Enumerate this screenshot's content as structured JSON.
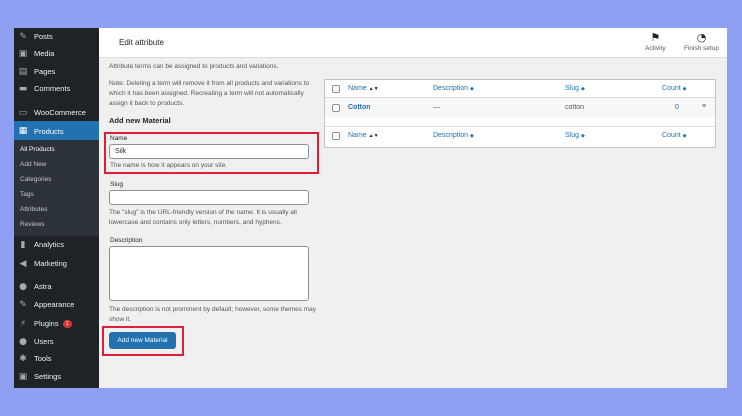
{
  "sidebar": {
    "items": [
      {
        "label": "Posts",
        "icon": "pin-icon"
      },
      {
        "label": "Media",
        "icon": "media-icon"
      },
      {
        "label": "Pages",
        "icon": "pages-icon"
      },
      {
        "label": "Comments",
        "icon": "comments-icon"
      },
      {
        "label": "WooCommerce",
        "icon": "woocommerce-icon"
      },
      {
        "label": "Products",
        "icon": "products-icon"
      },
      {
        "label": "Analytics",
        "icon": "analytics-icon"
      },
      {
        "label": "Marketing",
        "icon": "marketing-icon"
      },
      {
        "label": "Astra",
        "icon": "astra-icon"
      },
      {
        "label": "Appearance",
        "icon": "appearance-icon"
      },
      {
        "label": "Plugins",
        "icon": "plugins-icon",
        "badge": "1"
      },
      {
        "label": "Users",
        "icon": "users-icon"
      },
      {
        "label": "Tools",
        "icon": "tools-icon"
      },
      {
        "label": "Settings",
        "icon": "settings-icon"
      }
    ],
    "submenu": [
      "All Products",
      "Add New",
      "Categories",
      "Tags",
      "Attributes",
      "Reviews"
    ]
  },
  "header": {
    "title": "Edit attribute",
    "activity": "Activity",
    "finish_setup": "Finish setup"
  },
  "form": {
    "intro": "Attribute terms can be assigned to products and variations.",
    "note": "Note: Deleting a term will remove it from all products and variations to which it has been assigned. Recreating a term will not automatically assign it back to products.",
    "heading": "Add new Material",
    "name_label": "Name",
    "name_value": "Silk",
    "name_help": "The name is how it appears on your site.",
    "slug_label": "Slug",
    "slug_value": "",
    "slug_help": "The \"slug\" is the URL-friendly version of the name. It is usually all lowercase and contains only letters, numbers, and hyphens.",
    "description_label": "Description",
    "description_value": "",
    "description_help": "The description is not prominent by default; however, some themes may show it.",
    "submit_label": "Add new Material"
  },
  "table": {
    "columns": [
      "Name",
      "Description",
      "Slug",
      "Count"
    ],
    "sort_icons": [
      "▲▼",
      "◆",
      "◆",
      "◆"
    ],
    "rows": [
      {
        "name": "Cotton",
        "description": "—",
        "slug": "cotton",
        "count": "0"
      }
    ]
  },
  "colors": {
    "accent": "#2271b1",
    "highlight": "#e01e37",
    "sidebar_bg": "#1d2327",
    "page_bg": "#8fa0f2"
  }
}
